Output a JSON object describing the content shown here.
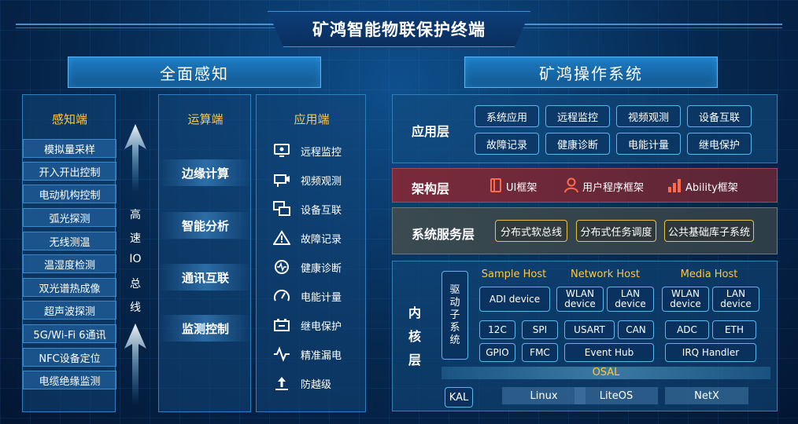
{
  "title": "矿鸿智能物联保护终端",
  "left_header": "全面感知",
  "right_header": "矿鸿操作系统",
  "sensing": {
    "title": "感知端",
    "items": [
      "模拟量采样",
      "开入开出控制",
      "电动机构控制",
      "弧光探测",
      "无线测温",
      "温湿度检测",
      "双光谱热成像",
      "超声波探测",
      "5G/Wi-Fi 6通讯",
      "NFC设备定位",
      "电缆绝缘监测"
    ]
  },
  "io_bus": [
    "高",
    "速",
    "IO",
    "总",
    "线"
  ],
  "compute": {
    "title": "运算端",
    "items": [
      "边缘计算",
      "智能分析",
      "通讯互联",
      "监测控制"
    ]
  },
  "app": {
    "title": "应用端",
    "items": [
      {
        "label": "远程监控",
        "icon": "monitor-icon"
      },
      {
        "label": "视频观测",
        "icon": "camera-icon"
      },
      {
        "label": "设备互联",
        "icon": "interconnect-icon"
      },
      {
        "label": "故障记录",
        "icon": "warning-icon"
      },
      {
        "label": "健康诊断",
        "icon": "health-icon"
      },
      {
        "label": "电能计量",
        "icon": "gauge-icon"
      },
      {
        "label": "继电保护",
        "icon": "relay-icon"
      },
      {
        "label": "精准漏电",
        "icon": "leakage-icon"
      },
      {
        "label": "防越级",
        "icon": "upload-icon"
      }
    ]
  },
  "app_layer": {
    "title": "应用层",
    "items": [
      "系统应用",
      "远程监控",
      "视频观测",
      "设备互联",
      "故障记录",
      "健康诊断",
      "电能计量",
      "继电保护"
    ]
  },
  "framework_layer": {
    "title": "架构层",
    "items": [
      {
        "label": "UI框架",
        "icon": "book-icon"
      },
      {
        "label": "用户程序框架",
        "icon": "user-icon"
      },
      {
        "label": "Ability框架",
        "icon": "bar-chart-icon"
      }
    ]
  },
  "service_layer": {
    "title": "系统服务层",
    "items": [
      "分布式软总线",
      "分布式任务调度",
      "公共基础库子系统"
    ]
  },
  "kernel_layer": {
    "title_chars": [
      "内",
      "核",
      "层"
    ],
    "driver": "驱动子系统",
    "hosts": [
      "Sample Host",
      "Network Host",
      "Media Host"
    ],
    "adi": "ADI device",
    "wlan": "WLAN device",
    "lan": "LAN device",
    "wlan2": "WLAN device",
    "lan2": "LAN device",
    "row1": [
      "12C",
      "SPI",
      "USART",
      "CAN",
      "ADC",
      "ETH"
    ],
    "row2": [
      "GPIO",
      "FMC",
      "Event Hub",
      "IRQ Handler"
    ],
    "osal": "OSAL",
    "kal": "KAL",
    "kernels": [
      "Linux",
      "LiteOS",
      "NetX"
    ]
  },
  "colors": {
    "accent_yellow": "#ffc844",
    "frame_blue": "#57b7ee",
    "framework_bg": "#7a2a3a"
  }
}
